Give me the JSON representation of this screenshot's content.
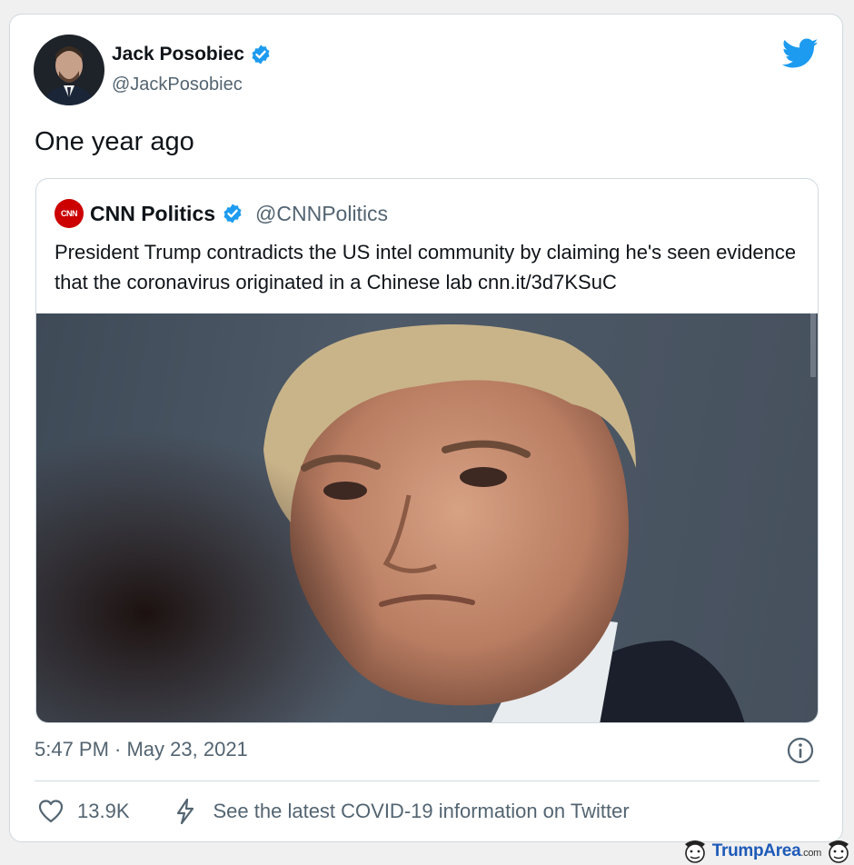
{
  "tweet": {
    "author_name": "Jack Posobiec",
    "author_handle": "@JackPosobiec",
    "text": "One year ago",
    "timestamp": "5:47 PM · May 23, 2021",
    "icons": {
      "platform": "twitter-bird-icon",
      "verified": "verified-badge-icon",
      "info": "info-icon"
    }
  },
  "quoted": {
    "logo_text": "CNN",
    "name": "CNN Politics",
    "handle": "@CNNPolitics",
    "text": "President Trump contradicts the US intel community by claiming he's seen evidence that the coronavirus originated in a Chinese lab cnn.it/3d7KSuC"
  },
  "actions": {
    "likes": "13.9K",
    "covid_link": "See the latest COVID-19 information on Twitter",
    "icons": {
      "like": "heart-icon",
      "covid": "bolt-icon"
    }
  },
  "watermark": {
    "brand_main": "Trump",
    "brand_accent": "Area",
    "brand_suffix": ".com"
  },
  "colors": {
    "twitter_blue": "#1d9bf0",
    "cnn_red": "#cc0000",
    "text_primary": "#0f1419",
    "text_secondary": "#536471"
  }
}
